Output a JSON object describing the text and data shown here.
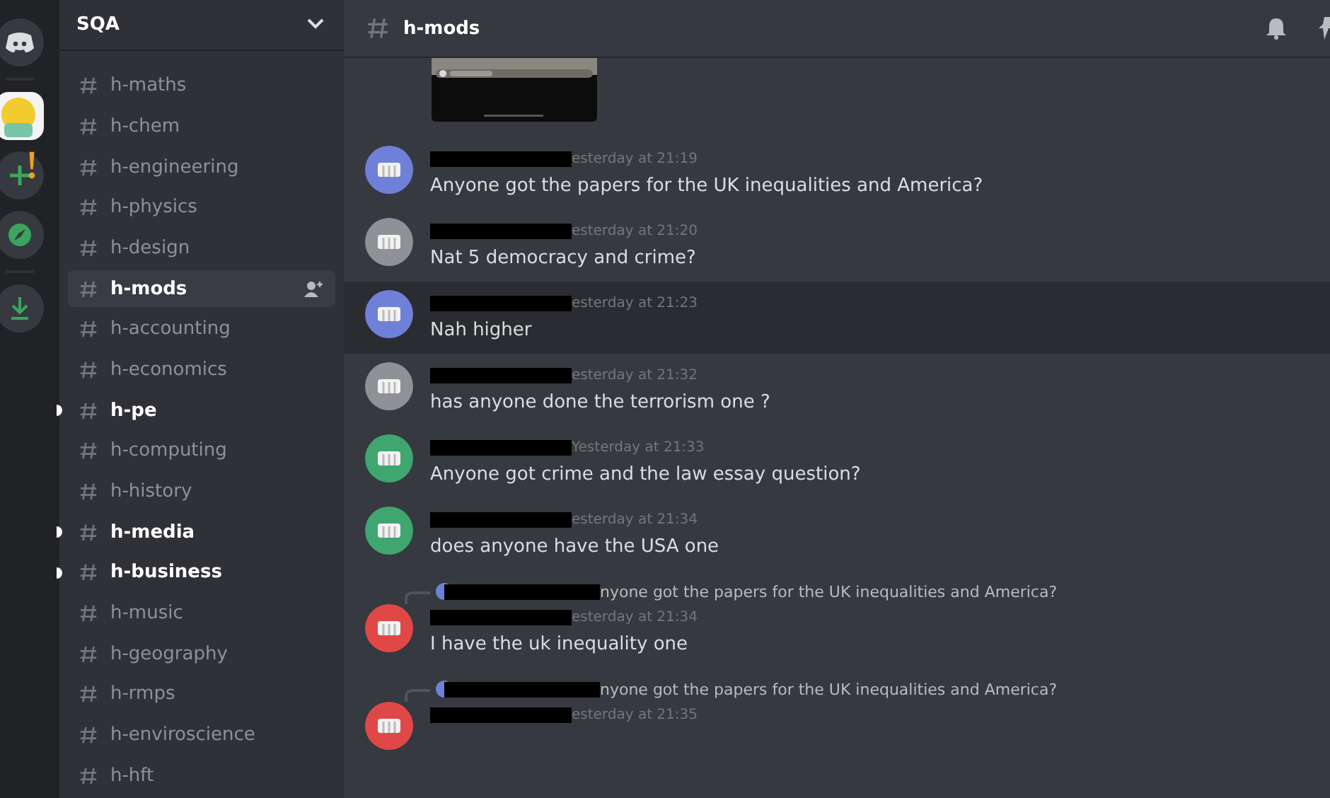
{
  "server": {
    "name": "SQA"
  },
  "channels": [
    {
      "name": "h-maths",
      "selected": false,
      "unread": false
    },
    {
      "name": "h-chem",
      "selected": false,
      "unread": false
    },
    {
      "name": "h-engineering",
      "selected": false,
      "unread": false
    },
    {
      "name": "h-physics",
      "selected": false,
      "unread": false
    },
    {
      "name": "h-design",
      "selected": false,
      "unread": false
    },
    {
      "name": "h-mods",
      "selected": true,
      "unread": false
    },
    {
      "name": "h-accounting",
      "selected": false,
      "unread": false
    },
    {
      "name": "h-economics",
      "selected": false,
      "unread": false
    },
    {
      "name": "h-pe",
      "selected": false,
      "unread": true
    },
    {
      "name": "h-computing",
      "selected": false,
      "unread": false
    },
    {
      "name": "h-history",
      "selected": false,
      "unread": false
    },
    {
      "name": "h-media",
      "selected": false,
      "unread": true
    },
    {
      "name": "h-business",
      "selected": false,
      "unread": true
    },
    {
      "name": "h-music",
      "selected": false,
      "unread": false
    },
    {
      "name": "h-geography",
      "selected": false,
      "unread": false
    },
    {
      "name": "h-rmps",
      "selected": false,
      "unread": false
    },
    {
      "name": "h-enviroscience",
      "selected": false,
      "unread": false
    },
    {
      "name": "h-hft",
      "selected": false,
      "unread": false
    }
  ],
  "header": {
    "channel": "h-mods"
  },
  "messages": [
    {
      "kind": "message",
      "color": "#6f80d8",
      "time": "esterday at 21:19",
      "text": "Anyone got the papers for the UK inequalities and America?",
      "highlighted": false
    },
    {
      "kind": "message",
      "color": "#8e9297",
      "time": "esterday at 21:20",
      "text": "Nat 5 democracy and crime?",
      "highlighted": false
    },
    {
      "kind": "message",
      "color": "#6f80d8",
      "time": "esterday at 21:23",
      "text": "Nah higher",
      "highlighted": true
    },
    {
      "kind": "message",
      "color": "#8e9297",
      "time": "esterday at 21:32",
      "text": "has anyone done the terrorism one ?",
      "highlighted": false
    },
    {
      "kind": "message",
      "color": "#3fa66f",
      "time": "Yesterday at 21:33",
      "text": "Anyone got crime and the law essay question?",
      "highlighted": false
    },
    {
      "kind": "message",
      "color": "#3fa66f",
      "time": "esterday at 21:34",
      "text": "does anyone have the USA one",
      "highlighted": false
    },
    {
      "kind": "reply",
      "color": "#e04848",
      "reply_text": "nyone got the papers for the UK inequalities and America?",
      "time": "esterday at 21:34",
      "text": "I have the uk inequality one",
      "highlighted": false
    },
    {
      "kind": "reply",
      "color": "#e04848",
      "reply_text": "nyone got the papers for the UK inequalities and America?",
      "time": "esterday at 21:35",
      "highlighted": false
    }
  ]
}
